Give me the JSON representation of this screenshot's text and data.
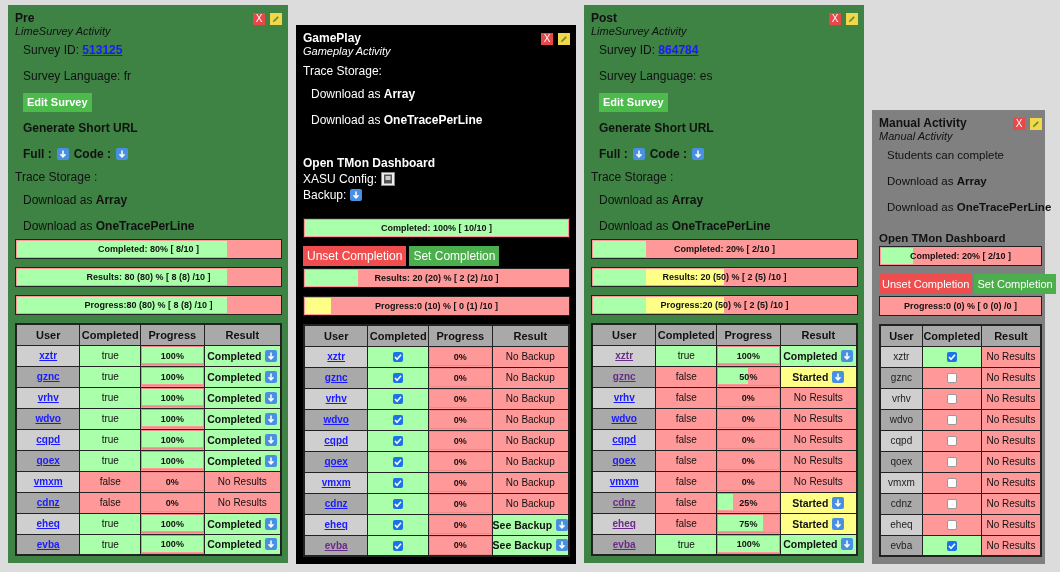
{
  "activities": [
    {
      "kind": "limesurvey",
      "title": "Pre",
      "subtitle": "LimeSurvey Activity",
      "color": "#3e8244",
      "close_label": "X",
      "items": [
        {
          "kind": "field",
          "label": "Survey ID:",
          "link": "513125"
        },
        {
          "kind": "text",
          "text": "Survey Language: fr"
        },
        {
          "kind": "button",
          "label": "Edit Survey"
        },
        {
          "kind": "strong-link",
          "label": "Generate Short URL"
        },
        {
          "kind": "downloads",
          "labels": [
            "Full :",
            "Code :"
          ]
        },
        {
          "kind": "heading",
          "text": "Trace Storage :"
        },
        {
          "kind": "format",
          "text": "Download as **Array**"
        },
        {
          "kind": "format",
          "text": "Download as **OneTracePerLine**"
        },
        {
          "kind": "bar",
          "label": "Completed: 80% [ 8/10 ]",
          "segments": [
            {
              "level": 0.8,
              "color": "#aaffaa"
            }
          ]
        },
        {
          "kind": "bar",
          "label": "Results: 80 (80) % [ 8 (8) /10 ]",
          "segments": [
            {
              "level": 0.8,
              "color": "#aaffaa"
            }
          ]
        },
        {
          "kind": "bar",
          "label": "Progress:80 (80) % [ 8 (8) /10 ]",
          "segments": [
            {
              "level": 0.8,
              "color": "#aaffaa"
            }
          ]
        }
      ],
      "table": {
        "columns": [
          "User",
          "Completed",
          "Progress",
          "Result"
        ],
        "rows": [
          {
            "cells": [
              {
                "kind": "user",
                "text": "xztr",
                "link": true,
                "visited": false
              },
              {
                "kind": "text",
                "text": "true",
                "color": "#aaffaa"
              },
              {
                "kind": "progress",
                "text": "100%",
                "level": 1
              },
              {
                "kind": "result",
                "text": "Completed",
                "download": true,
                "color": "#aaffaa"
              }
            ]
          },
          {
            "cells": [
              {
                "kind": "user",
                "text": "gznc",
                "link": true,
                "visited": false
              },
              {
                "kind": "text",
                "text": "true",
                "color": "#aaffaa"
              },
              {
                "kind": "progress",
                "text": "100%",
                "level": 1
              },
              {
                "kind": "result",
                "text": "Completed",
                "download": true,
                "color": "#aaffaa"
              }
            ]
          },
          {
            "cells": [
              {
                "kind": "user",
                "text": "vrhv",
                "link": true,
                "visited": false
              },
              {
                "kind": "text",
                "text": "true",
                "color": "#aaffaa"
              },
              {
                "kind": "progress",
                "text": "100%",
                "level": 1
              },
              {
                "kind": "result",
                "text": "Completed",
                "download": true,
                "color": "#aaffaa"
              }
            ]
          },
          {
            "cells": [
              {
                "kind": "user",
                "text": "wdvo",
                "link": true,
                "visited": false
              },
              {
                "kind": "text",
                "text": "true",
                "color": "#aaffaa"
              },
              {
                "kind": "progress",
                "text": "100%",
                "level": 1
              },
              {
                "kind": "result",
                "text": "Completed",
                "download": true,
                "color": "#aaffaa"
              }
            ]
          },
          {
            "cells": [
              {
                "kind": "user",
                "text": "cqpd",
                "link": true,
                "visited": false
              },
              {
                "kind": "text",
                "text": "true",
                "color": "#aaffaa"
              },
              {
                "kind": "progress",
                "text": "100%",
                "level": 1
              },
              {
                "kind": "result",
                "text": "Completed",
                "download": true,
                "color": "#aaffaa"
              }
            ]
          },
          {
            "cells": [
              {
                "kind": "user",
                "text": "qoex",
                "link": true,
                "visited": false
              },
              {
                "kind": "text",
                "text": "true",
                "color": "#aaffaa"
              },
              {
                "kind": "progress",
                "text": "100%",
                "level": 1
              },
              {
                "kind": "result",
                "text": "Completed",
                "download": true,
                "color": "#aaffaa"
              }
            ]
          },
          {
            "cells": [
              {
                "kind": "user",
                "text": "vmxm",
                "link": true,
                "visited": false
              },
              {
                "kind": "text",
                "text": "false",
                "color": "#ff9999"
              },
              {
                "kind": "progress",
                "text": "0%",
                "level": 0
              },
              {
                "kind": "result",
                "text": "No Results",
                "download": false,
                "color": "#ff9999"
              }
            ]
          },
          {
            "cells": [
              {
                "kind": "user",
                "text": "cdnz",
                "link": true,
                "visited": false
              },
              {
                "kind": "text",
                "text": "false",
                "color": "#ff9999"
              },
              {
                "kind": "progress",
                "text": "0%",
                "level": 0
              },
              {
                "kind": "result",
                "text": "No Results",
                "download": false,
                "color": "#ff9999"
              }
            ]
          },
          {
            "cells": [
              {
                "kind": "user",
                "text": "eheq",
                "link": true,
                "visited": false
              },
              {
                "kind": "text",
                "text": "true",
                "color": "#aaffaa"
              },
              {
                "kind": "progress",
                "text": "100%",
                "level": 1
              },
              {
                "kind": "result",
                "text": "Completed",
                "download": true,
                "color": "#aaffaa"
              }
            ]
          },
          {
            "cells": [
              {
                "kind": "user",
                "text": "evba",
                "link": true,
                "visited": false
              },
              {
                "kind": "text",
                "text": "true",
                "color": "#aaffaa"
              },
              {
                "kind": "progress",
                "text": "100%",
                "level": 1
              },
              {
                "kind": "result",
                "text": "Completed",
                "download": true,
                "color": "#aaffaa"
              }
            ]
          }
        ]
      }
    },
    {
      "kind": "gameplay",
      "title": "GamePlay",
      "subtitle": "Gameplay Activity",
      "color": "#000000",
      "close_label": "X",
      "items": [
        {
          "kind": "heading",
          "text": "Trace Storage:"
        },
        {
          "kind": "format",
          "text": "Download as **Array**"
        },
        {
          "kind": "format",
          "text": "Download as **OneTracePerLine**"
        },
        {
          "kind": "dashboard",
          "label": "Open TMon Dashboard"
        },
        {
          "kind": "config",
          "label": "XASU Config:"
        },
        {
          "kind": "backup",
          "label": "Backup:"
        },
        {
          "kind": "bar",
          "label": "Completed: 100% [ 10/10 ]",
          "segments": [
            {
              "level": 1,
              "color": "#aaffaa"
            }
          ]
        },
        {
          "kind": "buttons",
          "buttons": [
            {
              "label": "Unset Completion",
              "color": "#f04e4e"
            },
            {
              "label": "Set Completion",
              "color": "#4cae4c"
            }
          ]
        },
        {
          "kind": "bar",
          "label": "Results: 20 (20) % [ 2 (2) /10 ]",
          "segments": [
            {
              "level": 0.2,
              "color": "#aaffaa"
            }
          ]
        },
        {
          "kind": "bar",
          "label": "Progress:0 (10) % [ 0 (1) /10 ]",
          "segments": [
            {
              "level": 0.1,
              "color": "#ffff88"
            }
          ]
        }
      ],
      "table": {
        "columns": [
          "User",
          "Completed",
          "Progress",
          "Result"
        ],
        "rows": [
          {
            "cells": [
              {
                "kind": "user",
                "text": "xztr",
                "link": true,
                "visited": false
              },
              {
                "kind": "check",
                "checked": true,
                "color": "#aaffaa"
              },
              {
                "kind": "progress",
                "text": "0%",
                "level": 0
              },
              {
                "kind": "result",
                "text": "No Backup",
                "download": false,
                "color": "#ff9999"
              }
            ]
          },
          {
            "cells": [
              {
                "kind": "user",
                "text": "gznc",
                "link": true,
                "visited": false
              },
              {
                "kind": "check",
                "checked": true,
                "color": "#aaffaa"
              },
              {
                "kind": "progress",
                "text": "0%",
                "level": 0
              },
              {
                "kind": "result",
                "text": "No Backup",
                "download": false,
                "color": "#ff9999"
              }
            ]
          },
          {
            "cells": [
              {
                "kind": "user",
                "text": "vrhv",
                "link": true,
                "visited": false
              },
              {
                "kind": "check",
                "checked": true,
                "color": "#aaffaa"
              },
              {
                "kind": "progress",
                "text": "0%",
                "level": 0
              },
              {
                "kind": "result",
                "text": "No Backup",
                "download": false,
                "color": "#ff9999"
              }
            ]
          },
          {
            "cells": [
              {
                "kind": "user",
                "text": "wdvo",
                "link": true,
                "visited": false
              },
              {
                "kind": "check",
                "checked": true,
                "color": "#aaffaa"
              },
              {
                "kind": "progress",
                "text": "0%",
                "level": 0
              },
              {
                "kind": "result",
                "text": "No Backup",
                "download": false,
                "color": "#ff9999"
              }
            ]
          },
          {
            "cells": [
              {
                "kind": "user",
                "text": "cqpd",
                "link": true,
                "visited": false
              },
              {
                "kind": "check",
                "checked": true,
                "color": "#aaffaa"
              },
              {
                "kind": "progress",
                "text": "0%",
                "level": 0
              },
              {
                "kind": "result",
                "text": "No Backup",
                "download": false,
                "color": "#ff9999"
              }
            ]
          },
          {
            "cells": [
              {
                "kind": "user",
                "text": "qoex",
                "link": true,
                "visited": false
              },
              {
                "kind": "check",
                "checked": true,
                "color": "#aaffaa"
              },
              {
                "kind": "progress",
                "text": "0%",
                "level": 0
              },
              {
                "kind": "result",
                "text": "No Backup",
                "download": false,
                "color": "#ff9999"
              }
            ]
          },
          {
            "cells": [
              {
                "kind": "user",
                "text": "vmxm",
                "link": true,
                "visited": false
              },
              {
                "kind": "check",
                "checked": true,
                "color": "#aaffaa"
              },
              {
                "kind": "progress",
                "text": "0%",
                "level": 0
              },
              {
                "kind": "result",
                "text": "No Backup",
                "download": false,
                "color": "#ff9999"
              }
            ]
          },
          {
            "cells": [
              {
                "kind": "user",
                "text": "cdnz",
                "link": true,
                "visited": false
              },
              {
                "kind": "check",
                "checked": true,
                "color": "#aaffaa"
              },
              {
                "kind": "progress",
                "text": "0%",
                "level": 0
              },
              {
                "kind": "result",
                "text": "No Backup",
                "download": false,
                "color": "#ff9999"
              }
            ]
          },
          {
            "cells": [
              {
                "kind": "user",
                "text": "eheq",
                "link": true,
                "visited": false
              },
              {
                "kind": "check",
                "checked": true,
                "color": "#aaffaa"
              },
              {
                "kind": "progress",
                "text": "0%",
                "level": 0
              },
              {
                "kind": "result",
                "text": "See Backup",
                "download": true,
                "color": "#aaffaa"
              }
            ]
          },
          {
            "cells": [
              {
                "kind": "user",
                "text": "evba",
                "link": true,
                "visited": true
              },
              {
                "kind": "check",
                "checked": true,
                "color": "#aaffaa"
              },
              {
                "kind": "progress",
                "text": "0%",
                "level": 0
              },
              {
                "kind": "result",
                "text": "See Backup",
                "download": true,
                "color": "#aaffaa"
              }
            ]
          }
        ]
      }
    },
    {
      "kind": "limesurvey",
      "title": "Post",
      "subtitle": "LimeSurvey Activity",
      "color": "#3e8244",
      "close_label": "X",
      "items": [
        {
          "kind": "field",
          "label": "Survey ID:",
          "link": "864784"
        },
        {
          "kind": "text",
          "text": "Survey Language: es"
        },
        {
          "kind": "button",
          "label": "Edit Survey"
        },
        {
          "kind": "strong-link",
          "label": "Generate Short URL"
        },
        {
          "kind": "downloads",
          "labels": [
            "Full :",
            "Code :"
          ]
        },
        {
          "kind": "heading",
          "text": "Trace Storage :"
        },
        {
          "kind": "format",
          "text": "Download as **Array**"
        },
        {
          "kind": "format",
          "text": "Download as **OneTracePerLine**"
        },
        {
          "kind": "bar",
          "label": "Completed: 20% [ 2/10 ]",
          "segments": [
            {
              "level": 0.2,
              "color": "#aaffaa"
            }
          ]
        },
        {
          "kind": "bar",
          "label": "Results: 20 (50) % [ 2 (5) /10 ]",
          "segments": [
            {
              "level": 0.2,
              "color": "#aaffaa"
            },
            {
              "level": 0.3,
              "color": "#ffff88"
            }
          ]
        },
        {
          "kind": "bar",
          "label": "Progress:20 (50) % [ 2 (5) /10 ]",
          "segments": [
            {
              "level": 0.2,
              "color": "#aaffaa"
            },
            {
              "level": 0.3,
              "color": "#ffff88"
            }
          ]
        }
      ],
      "table": {
        "columns": [
          "User",
          "Completed",
          "Progress",
          "Result"
        ],
        "rows": [
          {
            "cells": [
              {
                "kind": "user",
                "text": "xztr",
                "link": true,
                "visited": true
              },
              {
                "kind": "text",
                "text": "true",
                "color": "#aaffaa"
              },
              {
                "kind": "progress",
                "text": "100%",
                "level": 1
              },
              {
                "kind": "result",
                "text": "Completed",
                "download": true,
                "color": "#aaffaa"
              }
            ]
          },
          {
            "cells": [
              {
                "kind": "user",
                "text": "gznc",
                "link": true,
                "visited": true
              },
              {
                "kind": "text",
                "text": "false",
                "color": "#ff9999"
              },
              {
                "kind": "progress",
                "text": "50%",
                "level": 0.5
              },
              {
                "kind": "result",
                "text": "Started",
                "download": true,
                "color": "#ffff88"
              }
            ]
          },
          {
            "cells": [
              {
                "kind": "user",
                "text": "vrhv",
                "link": true,
                "visited": false
              },
              {
                "kind": "text",
                "text": "false",
                "color": "#ff9999"
              },
              {
                "kind": "progress",
                "text": "0%",
                "level": 0
              },
              {
                "kind": "result",
                "text": "No Results",
                "download": false,
                "color": "#ff9999"
              }
            ]
          },
          {
            "cells": [
              {
                "kind": "user",
                "text": "wdvo",
                "link": true,
                "visited": false
              },
              {
                "kind": "text",
                "text": "false",
                "color": "#ff9999"
              },
              {
                "kind": "progress",
                "text": "0%",
                "level": 0
              },
              {
                "kind": "result",
                "text": "No Results",
                "download": false,
                "color": "#ff9999"
              }
            ]
          },
          {
            "cells": [
              {
                "kind": "user",
                "text": "cqpd",
                "link": true,
                "visited": false
              },
              {
                "kind": "text",
                "text": "false",
                "color": "#ff9999"
              },
              {
                "kind": "progress",
                "text": "0%",
                "level": 0
              },
              {
                "kind": "result",
                "text": "No Results",
                "download": false,
                "color": "#ff9999"
              }
            ]
          },
          {
            "cells": [
              {
                "kind": "user",
                "text": "qoex",
                "link": true,
                "visited": false
              },
              {
                "kind": "text",
                "text": "false",
                "color": "#ff9999"
              },
              {
                "kind": "progress",
                "text": "0%",
                "level": 0
              },
              {
                "kind": "result",
                "text": "No Results",
                "download": false,
                "color": "#ff9999"
              }
            ]
          },
          {
            "cells": [
              {
                "kind": "user",
                "text": "vmxm",
                "link": true,
                "visited": false
              },
              {
                "kind": "text",
                "text": "false",
                "color": "#ff9999"
              },
              {
                "kind": "progress",
                "text": "0%",
                "level": 0
              },
              {
                "kind": "result",
                "text": "No Results",
                "download": false,
                "color": "#ff9999"
              }
            ]
          },
          {
            "cells": [
              {
                "kind": "user",
                "text": "cdnz",
                "link": true,
                "visited": true
              },
              {
                "kind": "text",
                "text": "false",
                "color": "#ff9999"
              },
              {
                "kind": "progress",
                "text": "25%",
                "level": 0.25
              },
              {
                "kind": "result",
                "text": "Started",
                "download": true,
                "color": "#ffff88"
              }
            ]
          },
          {
            "cells": [
              {
                "kind": "user",
                "text": "eheq",
                "link": true,
                "visited": true
              },
              {
                "kind": "text",
                "text": "false",
                "color": "#ff9999"
              },
              {
                "kind": "progress",
                "text": "75%",
                "level": 0.75
              },
              {
                "kind": "result",
                "text": "Started",
                "download": true,
                "color": "#ffff88"
              }
            ]
          },
          {
            "cells": [
              {
                "kind": "user",
                "text": "evba",
                "link": true,
                "visited": true
              },
              {
                "kind": "text",
                "text": "true",
                "color": "#aaffaa"
              },
              {
                "kind": "progress",
                "text": "100%",
                "level": 1
              },
              {
                "kind": "result",
                "text": "Completed",
                "download": true,
                "color": "#aaffaa"
              }
            ]
          }
        ]
      }
    },
    {
      "kind": "manual",
      "title": "Manual Activity",
      "subtitle": "Manual Activity",
      "color": "#808080",
      "close_label": "X",
      "items": [
        {
          "kind": "text",
          "text": "Students can complete"
        },
        {
          "kind": "format",
          "text": "Download as **Array**"
        },
        {
          "kind": "format",
          "text": "Download as **OneTracePerLine**"
        },
        {
          "kind": "dashboard",
          "label": "Open TMon Dashboard"
        },
        {
          "kind": "bar",
          "label": "Completed: 20% [ 2/10 ]",
          "segments": [
            {
              "level": 0.2,
              "color": "#aaffaa"
            }
          ]
        },
        {
          "kind": "buttons",
          "buttons": [
            {
              "label": "Unset Completion",
              "color": "#f04e4e"
            },
            {
              "label": "Set Completion",
              "color": "#4cae4c"
            }
          ]
        },
        {
          "kind": "bar",
          "label": "Progress:0 (0) % [ 0 (0) /0 ]"
        }
      ],
      "table": {
        "columns": [
          "User",
          "Completed",
          "Result"
        ],
        "rows": [
          {
            "cells": [
              {
                "kind": "user",
                "text": "xztr",
                "link": false
              },
              {
                "kind": "check",
                "checked": true,
                "color": "#aaffaa"
              },
              {
                "kind": "result",
                "text": "No Results",
                "download": false,
                "color": "#ff9999"
              }
            ]
          },
          {
            "cells": [
              {
                "kind": "user",
                "text": "gznc",
                "link": false
              },
              {
                "kind": "check",
                "checked": false,
                "color": "#ff9999"
              },
              {
                "kind": "result",
                "text": "No Results",
                "download": false,
                "color": "#ff9999"
              }
            ]
          },
          {
            "cells": [
              {
                "kind": "user",
                "text": "vrhv",
                "link": false
              },
              {
                "kind": "check",
                "checked": false,
                "color": "#ff9999"
              },
              {
                "kind": "result",
                "text": "No Results",
                "download": false,
                "color": "#ff9999"
              }
            ]
          },
          {
            "cells": [
              {
                "kind": "user",
                "text": "wdvo",
                "link": false
              },
              {
                "kind": "check",
                "checked": false,
                "color": "#ff9999"
              },
              {
                "kind": "result",
                "text": "No Results",
                "download": false,
                "color": "#ff9999"
              }
            ]
          },
          {
            "cells": [
              {
                "kind": "user",
                "text": "cqpd",
                "link": false
              },
              {
                "kind": "check",
                "checked": false,
                "color": "#ff9999"
              },
              {
                "kind": "result",
                "text": "No Results",
                "download": false,
                "color": "#ff9999"
              }
            ]
          },
          {
            "cells": [
              {
                "kind": "user",
                "text": "qoex",
                "link": false
              },
              {
                "kind": "check",
                "checked": false,
                "color": "#ff9999"
              },
              {
                "kind": "result",
                "text": "No Results",
                "download": false,
                "color": "#ff9999"
              }
            ]
          },
          {
            "cells": [
              {
                "kind": "user",
                "text": "vmxm",
                "link": false
              },
              {
                "kind": "check",
                "checked": false,
                "color": "#ff9999"
              },
              {
                "kind": "result",
                "text": "No Results",
                "download": false,
                "color": "#ff9999"
              }
            ]
          },
          {
            "cells": [
              {
                "kind": "user",
                "text": "cdnz",
                "link": false
              },
              {
                "kind": "check",
                "checked": false,
                "color": "#ff9999"
              },
              {
                "kind": "result",
                "text": "No Results",
                "download": false,
                "color": "#ff9999"
              }
            ]
          },
          {
            "cells": [
              {
                "kind": "user",
                "text": "eheq",
                "link": false
              },
              {
                "kind": "check",
                "checked": false,
                "color": "#ff9999"
              },
              {
                "kind": "result",
                "text": "No Results",
                "download": false,
                "color": "#ff9999"
              }
            ]
          },
          {
            "cells": [
              {
                "kind": "user",
                "text": "evba",
                "link": false
              },
              {
                "kind": "check",
                "checked": true,
                "color": "#aaffaa"
              },
              {
                "kind": "result",
                "text": "No Results",
                "download": false,
                "color": "#ff9999"
              }
            ]
          }
        ]
      }
    }
  ]
}
